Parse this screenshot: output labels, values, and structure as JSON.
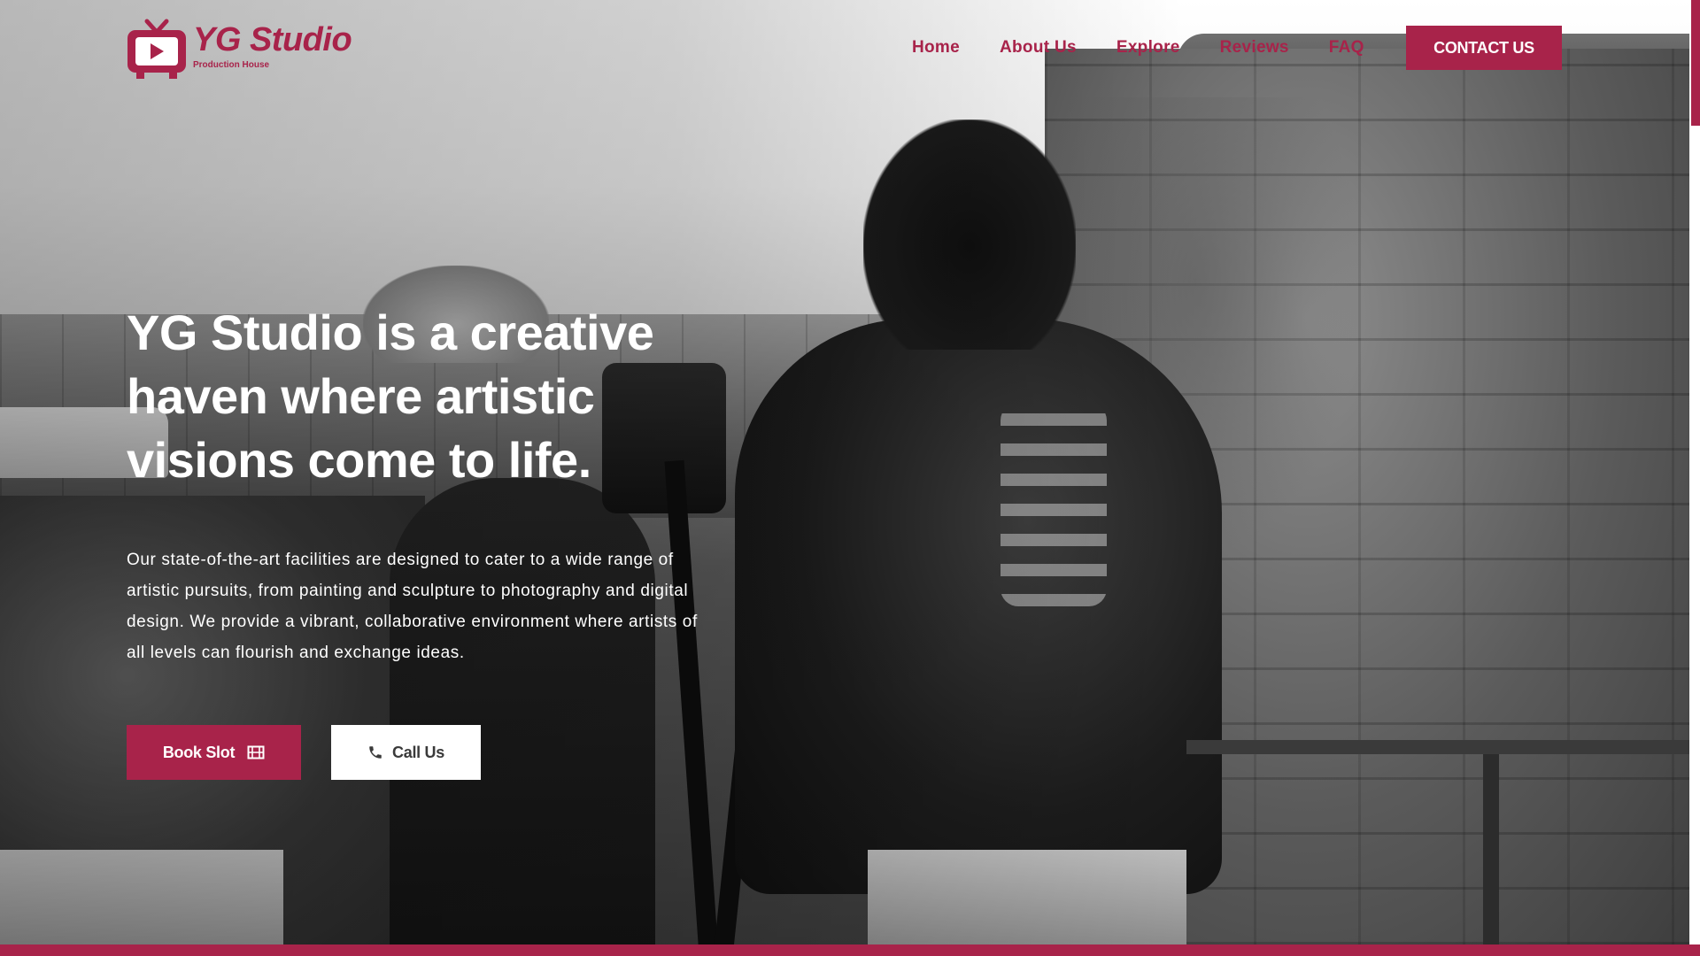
{
  "colors": {
    "brand": "#a8234a",
    "white": "#ffffff",
    "call_text": "#3a3a3a"
  },
  "header": {
    "logo": {
      "title": "YG Studio",
      "subtitle": "Production House",
      "icon": "tv-play-icon"
    },
    "nav": [
      {
        "label": "Home"
      },
      {
        "label": "About Us"
      },
      {
        "label": "Explore"
      },
      {
        "label": "Reviews"
      },
      {
        "label": "FAQ"
      }
    ],
    "contact_label": "CONTACT US"
  },
  "hero": {
    "headline": "YG Studio is a creative haven where artistic visions come to life.",
    "description": "Our state-of-the-art facilities are designed to cater to a wide range of artistic pursuits, from painting and sculpture to photography and digital design. We provide a vibrant, collaborative environment where artists of all levels can flourish and exchange ideas.",
    "book_button": {
      "label": "Book Slot",
      "icon": "film-icon"
    },
    "call_button": {
      "label": "Call Us",
      "icon": "phone-icon"
    },
    "background_image": "grayscale photo of a boy in a black jacket and a man with a camera on a tripod beside a stone wall"
  }
}
